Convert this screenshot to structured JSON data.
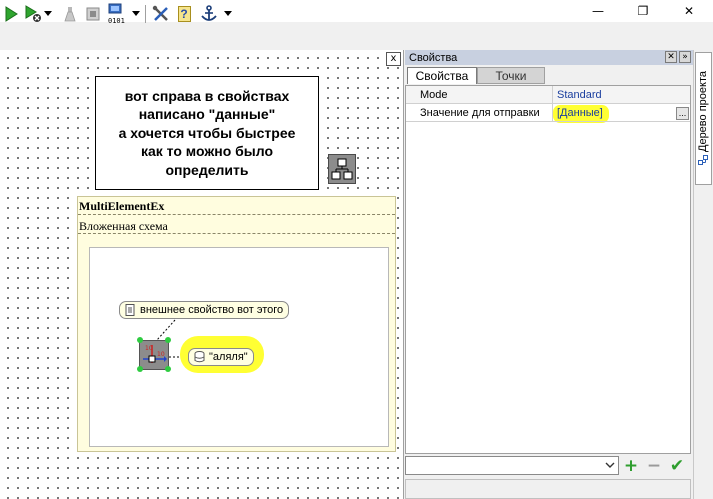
{
  "window": {
    "minimize_icon": "minimize-icon",
    "maximize_icon": "restore-icon",
    "close_icon": "close-icon",
    "min_glyph": "—",
    "max_glyph": "❐",
    "close_glyph": "✕"
  },
  "toolbar": {
    "items": [
      "run-icon",
      "run-stop-icon",
      "flask-icon",
      "stop-square-icon",
      "binary-export-icon",
      "tools-icon",
      "help-icon",
      "anchor-icon"
    ],
    "binary_text": "0101",
    "help_text": "?"
  },
  "canvas": {
    "close_glyph": "x",
    "note_lines": [
      "вот справа в свойствах",
      "написано \"данные\"",
      "а хочется чтобы быстрее",
      "как то можно было",
      "определить"
    ],
    "multi_title": "MultiElementEx",
    "multi_subtitle": "Вложенная схема",
    "external_property": "внешнее свойство вот этого",
    "element_label": "\"аляля\"",
    "elem_num_top": "10",
    "elem_num_side": "10",
    "highlight_color": "#ffff33"
  },
  "properties": {
    "title": "Свойства",
    "tabs": [
      {
        "label": "Свойства",
        "active": true
      },
      {
        "label": "Точки",
        "active": false
      }
    ],
    "rows": [
      {
        "name": "Mode",
        "value": "Standard"
      },
      {
        "name": "Значение для отправки",
        "value": "[Данные]"
      }
    ],
    "ellipsis": "...",
    "combo_value": "",
    "add_glyph": "+",
    "remove_glyph": "−",
    "apply_glyph": "✔"
  },
  "side_tab": {
    "label": "Дерево проекта"
  }
}
